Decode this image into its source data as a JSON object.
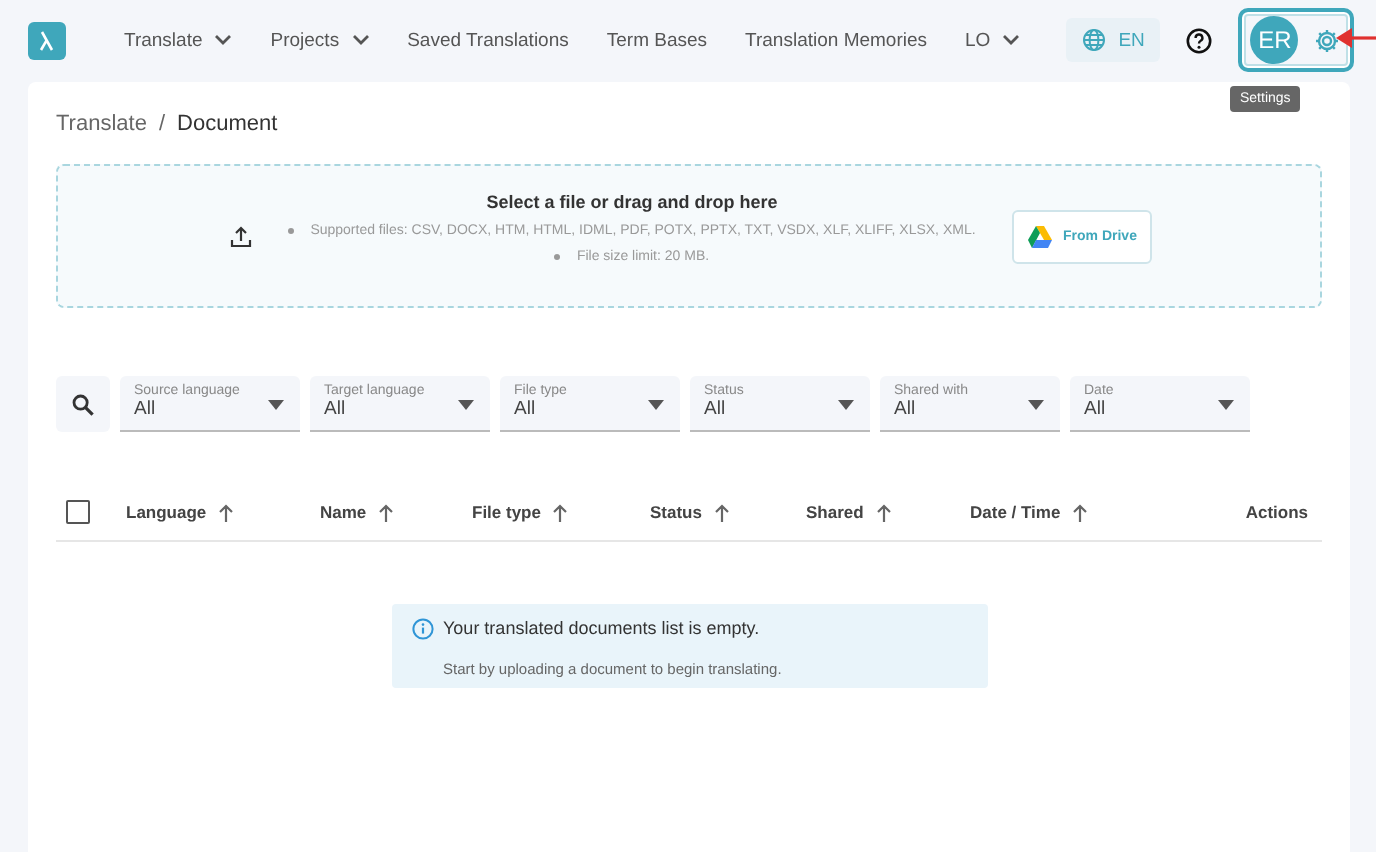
{
  "nav": {
    "items": [
      {
        "label": "Translate",
        "kind": "dropdown"
      },
      {
        "label": "Projects",
        "kind": "dropdown"
      },
      {
        "label": "Saved Translations",
        "kind": "link"
      },
      {
        "label": "Term Bases",
        "kind": "link"
      },
      {
        "label": "Translation Memories",
        "kind": "link"
      },
      {
        "label": "LO",
        "kind": "dropdown"
      }
    ],
    "language": "EN",
    "avatar": "ER",
    "tooltip": "Settings"
  },
  "breadcrumb": {
    "items": [
      "Translate",
      "Document"
    ],
    "separator": "/"
  },
  "upload": {
    "title": "Select a file or drag and drop here",
    "notes": [
      "Supported files: CSV, DOCX, HTM, HTML, IDML, PDF, POTX, PPTX, TXT, VSDX, XLF, XLIFF, XLSX, XML.",
      "File size limit: 20 MB."
    ],
    "drive_button": "From Drive"
  },
  "filters": [
    {
      "label": "Source language",
      "value": "All"
    },
    {
      "label": "Target language",
      "value": "All"
    },
    {
      "label": "File type",
      "value": "All"
    },
    {
      "label": "Status",
      "value": "All"
    },
    {
      "label": "Shared with",
      "value": "All"
    },
    {
      "label": "Date",
      "value": "All"
    }
  ],
  "table": {
    "select_all": {
      "checked": false
    },
    "columns": [
      {
        "label": "Language",
        "sortable": true
      },
      {
        "label": "Name",
        "sortable": true
      },
      {
        "label": "File type",
        "sortable": true
      },
      {
        "label": "Status",
        "sortable": true
      },
      {
        "label": "Shared",
        "sortable": true
      },
      {
        "label": "Date / Time",
        "sortable": true
      },
      {
        "label": "Actions",
        "sortable": false
      }
    ]
  },
  "empty_state": {
    "title": "Your translated documents list is empty.",
    "message": "Start by uploading a document to begin translating."
  }
}
